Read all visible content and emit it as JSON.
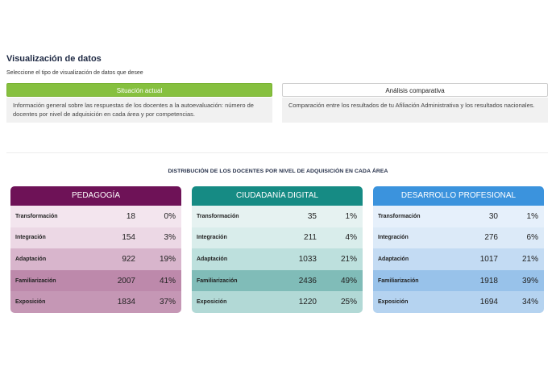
{
  "header": {
    "title": "Visualización de datos",
    "subtitle": "Seleccione el tipo de visualización de datos que desee"
  },
  "views": [
    {
      "label": "Situación actual",
      "description": "Información general sobre las respuestas de los docentes a la autoevaluación: número de docentes por nivel de adquisición en cada área y por competencias."
    },
    {
      "label": "Análisis comparativa",
      "description": "Comparación entre los resultados de tu Afiliación Administrativa y los resultados nacionales."
    }
  ],
  "section_title": "DISTRIBUCIÓN DE LOS DOCENTES POR NIVEL DE ADQUISICIÓN EN CADA ÁREA",
  "areas": [
    {
      "name": "PEDAGOGÍA",
      "header_color": "#6e1257",
      "row_colors": [
        "#f3e5ee",
        "#ecd8e5",
        "#d8b5cc",
        "#bd89ab",
        "#c597b5"
      ],
      "rows": [
        {
          "level": "Transformación",
          "count": "18",
          "pct": "0%"
        },
        {
          "level": "Integración",
          "count": "154",
          "pct": "3%"
        },
        {
          "level": "Adaptación",
          "count": "922",
          "pct": "19%"
        },
        {
          "level": "Familiarización",
          "count": "2007",
          "pct": "41%"
        },
        {
          "level": "Exposición",
          "count": "1834",
          "pct": "37%"
        }
      ]
    },
    {
      "name": "CIUDADANÍA DIGITAL",
      "header_color": "#168b84",
      "row_colors": [
        "#e6f2f1",
        "#d9edeb",
        "#bde0dd",
        "#80bcb8",
        "#b2d9d6"
      ],
      "rows": [
        {
          "level": "Transformación",
          "count": "35",
          "pct": "1%"
        },
        {
          "level": "Integración",
          "count": "211",
          "pct": "4%"
        },
        {
          "level": "Adaptación",
          "count": "1033",
          "pct": "21%"
        },
        {
          "level": "Familiarización",
          "count": "2436",
          "pct": "49%"
        },
        {
          "level": "Exposición",
          "count": "1220",
          "pct": "25%"
        }
      ]
    },
    {
      "name": "DESARROLLO PROFESIONAL",
      "header_color": "#3b93dd",
      "row_colors": [
        "#e6f0fb",
        "#dceaf8",
        "#c3dbf3",
        "#98c2ea",
        "#b5d3f0"
      ],
      "rows": [
        {
          "level": "Transformación",
          "count": "30",
          "pct": "1%"
        },
        {
          "level": "Integración",
          "count": "276",
          "pct": "6%"
        },
        {
          "level": "Adaptación",
          "count": "1017",
          "pct": "21%"
        },
        {
          "level": "Familiarización",
          "count": "1918",
          "pct": "39%"
        },
        {
          "level": "Exposición",
          "count": "1694",
          "pct": "34%"
        }
      ]
    }
  ]
}
